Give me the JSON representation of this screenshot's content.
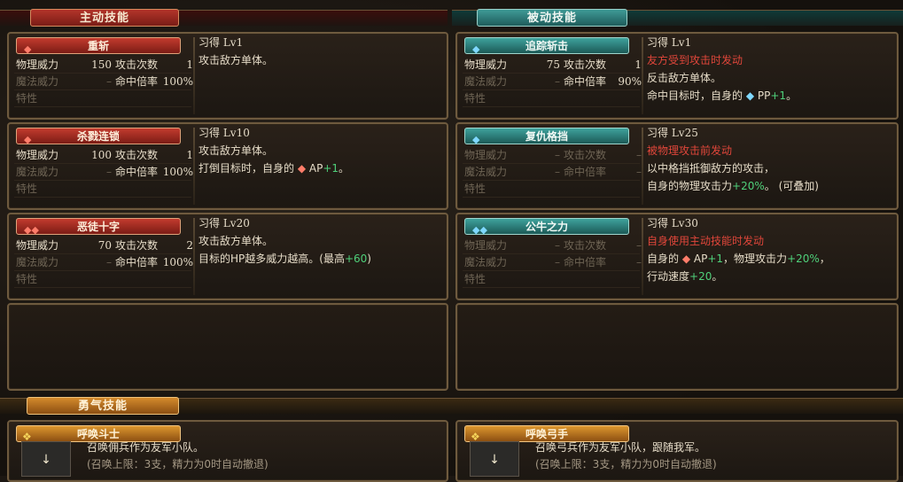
{
  "sections": {
    "active": "主动技能",
    "passive": "被动技能",
    "brave": "勇气技能"
  },
  "labels": {
    "phys": "物理威力",
    "hits": "攻击次数",
    "magic": "魔法威力",
    "acc": "命中倍率",
    "trait": "特性",
    "dash": "–"
  },
  "active": [
    {
      "name": "重斩",
      "learn": "习得 Lv1",
      "phys": "150",
      "hits": "1",
      "acc": "100%",
      "desc1": "攻击敌方单体。",
      "desc2": ""
    },
    {
      "name": "杀戮连锁",
      "learn": "习得 Lv10",
      "phys": "100",
      "hits": "1",
      "acc": "100%",
      "desc1": "攻击敌方单体。",
      "desc2a": "打倒目标时，自身的 ",
      "desc2b": "AP",
      "desc2c": "+1",
      "desc2d": "。"
    },
    {
      "name": "恶徒十字",
      "learn": "习得 Lv20",
      "phys": "70",
      "hits": "2",
      "acc": "100%",
      "desc1": "攻击敌方单体。",
      "desc2a": "目标的HP越多威力越高。(最高",
      "desc2b": "+60",
      "desc2c": ")"
    }
  ],
  "passive": [
    {
      "name": "追踪斩击",
      "learn": "习得 Lv1",
      "phys": "75",
      "hits": "1",
      "acc": "90%",
      "trigger": "友方受到攻击时发动",
      "desc1": "反击敌方单体。",
      "desc2a": "命中目标时，自身的 ",
      "desc2b": "PP",
      "desc2c": "+1",
      "desc2d": "。"
    },
    {
      "name": "复仇格挡",
      "learn": "习得 Lv25",
      "trigger": "被物理攻击前发动",
      "desc1": "以中格挡抵御敌方的攻击，",
      "desc2a": "自身的物理攻击力",
      "desc2b": "+20%",
      "desc2c": "。 (可叠加)"
    },
    {
      "name": "公牛之力",
      "learn": "习得 Lv30",
      "trigger": "自身使用主动技能时发动",
      "desc1a": "自身的 ",
      "desc1b": "AP",
      "desc1c": "+1",
      "desc1d": "，物理攻击力",
      "desc1e": "+20%",
      "desc1f": "，",
      "desc2a": "行动速度",
      "desc2b": "+20",
      "desc2c": "。"
    }
  ],
  "brave": [
    {
      "name": "呼唤斗士",
      "desc1": "召唤佣兵作为友军小队。",
      "desc2": "(召唤上限：3支，精力为0时自动撤退)"
    },
    {
      "name": "呼唤弓手",
      "desc1": "召唤弓兵作为友军小队，跟随我军。",
      "desc2": "(召唤上限：3支，精力为0时自动撤退)"
    }
  ],
  "colors": {
    "trigger": "#e0463a",
    "bonus": "#4fd07a"
  },
  "icons": {
    "active_gem": "red-gem-icon",
    "passive_gem": "blue-gem-icon",
    "brave": "feather-icon",
    "summon": "down-arrow-icon"
  }
}
